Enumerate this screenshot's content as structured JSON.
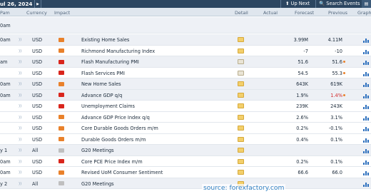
{
  "topbar": {
    "date": "ul 26, 2024",
    "play_glyph": "▶",
    "up_next": "⬆ Up Next",
    "search_events": "🔍 Search Events",
    "graph_icon": "graph-icon"
  },
  "columns": {
    "time": "Pam",
    "currency": "Currency",
    "impact": "Impact",
    "detail": "Detail",
    "actual": "Actual",
    "forecast": "Forecast",
    "previous": "Previous",
    "graph": "Graph"
  },
  "day_label": "0am",
  "events": [
    {
      "time": "0am",
      "currency": "USD",
      "impact": "orange",
      "event": "Existing Home Sales",
      "detail": "folder",
      "forecast": "3.99M",
      "previous": "4.11M",
      "previous_revised": false,
      "previous_red": false
    },
    {
      "time": "",
      "currency": "USD",
      "impact": "orange",
      "event": "Richmond Manufacturing Index",
      "detail": "folder",
      "forecast": "-7",
      "previous": "-10",
      "previous_revised": false,
      "previous_red": false
    },
    {
      "time": "am",
      "currency": "USD",
      "impact": "red",
      "event": "Flash Manufacturing PMI",
      "detail": "alt",
      "forecast": "51.6",
      "previous": "51.6",
      "previous_revised": true,
      "previous_red": false
    },
    {
      "time": "",
      "currency": "USD",
      "impact": "red",
      "event": "Flash Services PMI",
      "detail": "alt",
      "forecast": "54.5",
      "previous": "55.3",
      "previous_revised": true,
      "previous_red": false
    },
    {
      "time": "0am",
      "currency": "USD",
      "impact": "orange",
      "event": "New Home Sales",
      "detail": "folder",
      "forecast": "643K",
      "previous": "619K",
      "previous_revised": false,
      "previous_red": false
    },
    {
      "time": "0am",
      "currency": "USD",
      "impact": "red",
      "event": "Advance GDP q/q",
      "detail": "folder",
      "forecast": "1.9%",
      "previous": "1.4%",
      "previous_revised": true,
      "previous_red": true
    },
    {
      "time": "",
      "currency": "USD",
      "impact": "red",
      "event": "Unemployment Claims",
      "detail": "folder",
      "forecast": "239K",
      "previous": "243K",
      "previous_revised": false,
      "previous_red": false
    },
    {
      "time": "",
      "currency": "USD",
      "impact": "orange",
      "event": "Advance GDP Price Index q/q",
      "detail": "folder",
      "forecast": "2.6%",
      "previous": "3.1%",
      "previous_revised": false,
      "previous_red": false
    },
    {
      "time": "",
      "currency": "USD",
      "impact": "orange",
      "event": "Core Durable Goods Orders m/m",
      "detail": "folder",
      "forecast": "0.2%",
      "previous": "-0.1%",
      "previous_revised": false,
      "previous_red": false
    },
    {
      "time": "",
      "currency": "USD",
      "impact": "orange",
      "event": "Durable Goods Orders m/m",
      "detail": "folder",
      "forecast": "0.4%",
      "previous": "0.1%",
      "previous_revised": false,
      "previous_red": false
    },
    {
      "time": "y 1",
      "currency": "All",
      "impact": "gray",
      "event": "G20 Meetings",
      "detail": "folder",
      "forecast": "",
      "previous": "",
      "previous_revised": false,
      "previous_red": false
    },
    {
      "time": "0am",
      "currency": "USD",
      "impact": "red",
      "event": "Core PCE Price Index m/m",
      "detail": "folder",
      "forecast": "0.2%",
      "previous": "0.1%",
      "previous_revised": false,
      "previous_red": false
    },
    {
      "time": "0am",
      "currency": "USD",
      "impact": "orange",
      "event": "Revised UoM Consumer Sentiment",
      "detail": "folder",
      "forecast": "66.6",
      "previous": "66.0",
      "previous_revised": false,
      "previous_red": false
    },
    {
      "time": "y 2",
      "currency": "All",
      "impact": "gray",
      "event": "G20 Meetings",
      "detail": "folder",
      "forecast": "",
      "previous": "",
      "previous_revised": false,
      "previous_red": false
    }
  ],
  "source": "source: forexfactory.com"
}
